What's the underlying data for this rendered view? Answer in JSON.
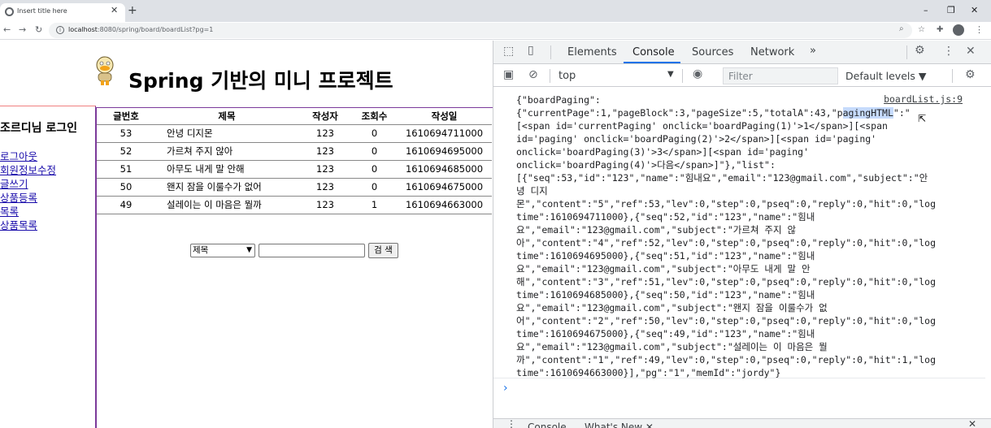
{
  "browser": {
    "tab_title": "Insert title here",
    "tab_close": "✕",
    "new_tab": "+",
    "url_host": "localhost",
    "url_path": ":8080/spring/board/boardList?pg=1",
    "win_min": "–",
    "win_restore": "❐",
    "win_close": "✕",
    "profile_initial": "●"
  },
  "page": {
    "title": "Spring 기반의 미니 프로젝트",
    "welcome": "조르디님 로그인",
    "menu": [
      "로그아웃",
      "회원정보수정",
      "글쓰기",
      "상품등록",
      "목록",
      "상품목록"
    ],
    "table_headers": [
      "글번호",
      "제목",
      "작성자",
      "조회수",
      "작성일"
    ],
    "rows": [
      {
        "seq": "53",
        "subject": "안녕 디지몬",
        "writer": "123",
        "hit": "0",
        "date": "1610694711000"
      },
      {
        "seq": "52",
        "subject": "가르쳐 주지 않아",
        "writer": "123",
        "hit": "0",
        "date": "1610694695000"
      },
      {
        "seq": "51",
        "subject": "아무도 내게 말 안해",
        "writer": "123",
        "hit": "0",
        "date": "1610694685000"
      },
      {
        "seq": "50",
        "subject": "왠지 잠을 이룰수가 없어",
        "writer": "123",
        "hit": "0",
        "date": "1610694675000"
      },
      {
        "seq": "49",
        "subject": "설레이는 이 마음은 뭘까",
        "writer": "123",
        "hit": "1",
        "date": "1610694663000"
      }
    ],
    "search_option": "제목",
    "search_button": "검 색"
  },
  "devtools": {
    "tabs": [
      "Elements",
      "Console",
      "Sources",
      "Network"
    ],
    "more": "»",
    "context": "top",
    "filter_placeholder": "Filter",
    "levels": "Default levels ▼",
    "source_link": "boardList.js:9",
    "output_pre": "{\"boardPaging\":\n{\"currentPage\":1,\"pageBlock\":3,\"pageSize\":5,\"totalA\":43,\"p",
    "output_hl": "agingHTML",
    "output_post": "\":\"\n[<span id='currentPaging' onclick='boardPaging(1)'>1</span>][<span\nid='paging' onclick='boardPaging(2)'>2</span>][<span id='paging'\nonclick='boardPaging(3)'>3</span>][<span id='paging'\nonclick='boardPaging(4)'>다음</span>]\"},\"list\":\n[{\"seq\":53,\"id\":\"123\",\"name\":\"힘내요\",\"email\":\"123@gmail.com\",\"subject\":\"안\n녕 디지\n몬\",\"content\":\"5\",\"ref\":53,\"lev\":0,\"step\":0,\"pseq\":0,\"reply\":0,\"hit\":0,\"log\ntime\":1610694711000},{\"seq\":52,\"id\":\"123\",\"name\":\"힘내\n요\",\"email\":\"123@gmail.com\",\"subject\":\"가르쳐 주지 않\n아\",\"content\":\"4\",\"ref\":52,\"lev\":0,\"step\":0,\"pseq\":0,\"reply\":0,\"hit\":0,\"log\ntime\":1610694695000},{\"seq\":51,\"id\":\"123\",\"name\":\"힘내\n요\",\"email\":\"123@gmail.com\",\"subject\":\"아무도 내게 말 안\n해\",\"content\":\"3\",\"ref\":51,\"lev\":0,\"step\":0,\"pseq\":0,\"reply\":0,\"hit\":0,\"log\ntime\":1610694685000},{\"seq\":50,\"id\":\"123\",\"name\":\"힘내\n요\",\"email\":\"123@gmail.com\",\"subject\":\"왠지 잠을 이룰수가 없\n어\",\"content\":\"2\",\"ref\":50,\"lev\":0,\"step\":0,\"pseq\":0,\"reply\":0,\"hit\":0,\"log\ntime\":1610694675000},{\"seq\":49,\"id\":\"123\",\"name\":\"힘내\n요\",\"email\":\"123@gmail.com\",\"subject\":\"설레이는 이 마음은 뭘\n까\",\"content\":\"1\",\"ref\":49,\"lev\":0,\"step\":0,\"pseq\":0,\"reply\":0,\"hit\":1,\"log\ntime\":1610694663000}],\"pg\":\"1\",\"memId\":\"jordy\"}",
    "prompt": "›",
    "drawer_tabs": [
      "Console",
      "What's New ✕"
    ]
  },
  "colors": {
    "accent": "#1a73e8",
    "link": "#1a0dab",
    "highlight": "#c6dbfc"
  }
}
